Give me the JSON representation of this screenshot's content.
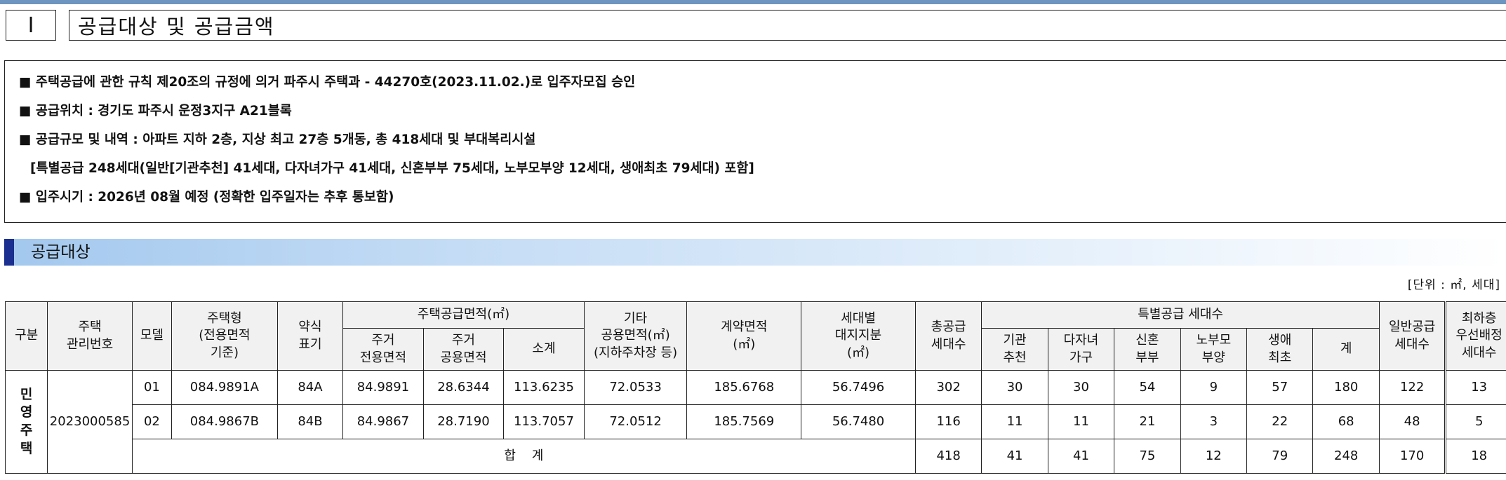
{
  "header": {
    "number": "Ⅰ",
    "title": "공급대상 및 공급금액"
  },
  "notice": {
    "lines": [
      "■ 주택공급에 관한 규칙 제20조의 규정에 의거 파주시 주택과 - 44270호(2023.11.02.)로 입주자모집 승인",
      "■ 공급위치 : 경기도 파주시 운정3지구 A21블록",
      "■ 공급규모 및 내역 : 아파트 지하 2층, 지상 최고 27층 5개동, 총 418세대 및 부대복리시설",
      "[특별공급 248세대(일반[기관추천] 41세대, 다자녀가구 41세대, 신혼부부 75세대, 노부모부양 12세대, 생애최초 79세대) 포함]",
      "■ 입주시기 : 2026년 08월 예정 (정확한 입주일자는 추후 통보함)"
    ]
  },
  "section": {
    "title": "공급대상",
    "unit": "[단위 : ㎡, 세대]"
  },
  "table": {
    "headers": {
      "category": "구분",
      "mgmt_no": "주택\n관리번호",
      "model": "모델",
      "housing_type": "주택형\n(전용면적\n기준)",
      "abbr": "약식\n표기",
      "supply_area": "주택공급면적(㎡)",
      "exclusive": "주거\n전용면적",
      "common": "주거\n공용면적",
      "subtotal": "소계",
      "other_common": "기타\n공용면적(㎡)\n(지하주차장 등)",
      "contract_area": "계약면적\n(㎡)",
      "land_share": "세대별\n대지지분\n(㎡)",
      "total_units": "총공급\n세대수",
      "special": "특별공급 세대수",
      "agency": "기관\n추천",
      "multi_child": "다자녀\n가구",
      "newlywed": "신혼\n부부",
      "elderly": "노부모\n부양",
      "first_time": "생애\n최초",
      "special_total": "계",
      "general": "일반공급\n세대수",
      "top_floor": "최하층\n우선배정\n세대수"
    },
    "category_value": "민\n영\n주\n택",
    "mgmt_no_value": "2023000585",
    "rows": [
      {
        "model": "01",
        "type": "084.9891A",
        "abbr": "84A",
        "exclusive": "84.9891",
        "common": "28.6344",
        "subtotal": "113.6235",
        "other": "72.0533",
        "contract": "185.6768",
        "land": "56.7496",
        "total": "302",
        "agency": "30",
        "multi": "30",
        "newlywed": "54",
        "elderly": "9",
        "first": "57",
        "sp_total": "180",
        "general": "122",
        "top": "13"
      },
      {
        "model": "02",
        "type": "084.9867B",
        "abbr": "84B",
        "exclusive": "84.9867",
        "common": "28.7190",
        "subtotal": "113.7057",
        "other": "72.0512",
        "contract": "185.7569",
        "land": "56.7480",
        "total": "116",
        "agency": "11",
        "multi": "11",
        "newlywed": "21",
        "elderly": "3",
        "first": "22",
        "sp_total": "68",
        "general": "48",
        "top": "5"
      }
    ],
    "sum": {
      "label": "합    계",
      "total": "418",
      "agency": "41",
      "multi": "41",
      "newlywed": "75",
      "elderly": "12",
      "first": "79",
      "sp_total": "248",
      "general": "170",
      "top": "18"
    }
  }
}
